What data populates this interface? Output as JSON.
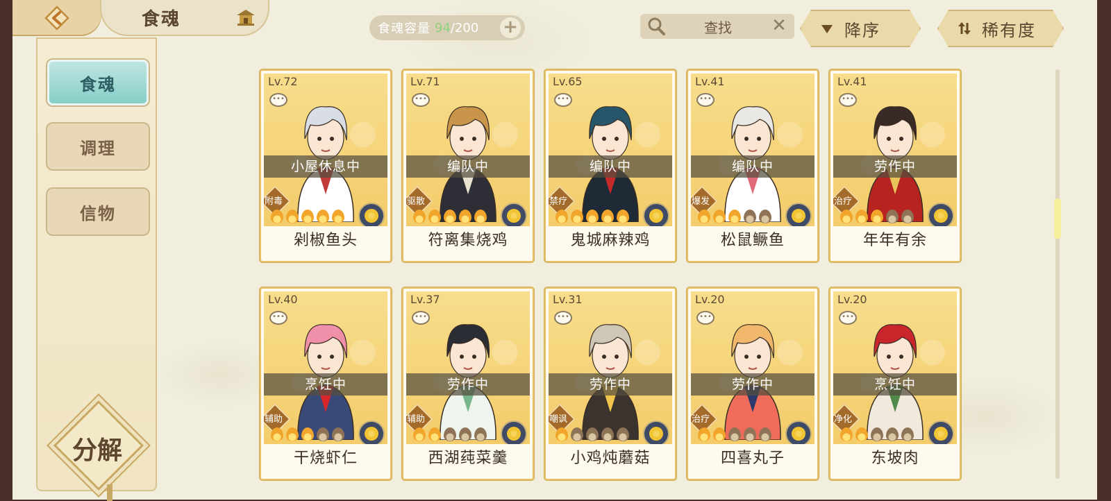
{
  "header": {
    "title": "食魂"
  },
  "capacity": {
    "label": "食魂容量",
    "current": "94",
    "max": "/200",
    "add": "+"
  },
  "search": {
    "text": "查找",
    "clear": "✕"
  },
  "sort": {
    "order_label": "降序",
    "filter_label": "稀有度"
  },
  "sidebar": {
    "items": [
      "食魂",
      "调理",
      "信物"
    ],
    "decompose": "分解"
  },
  "cards": [
    {
      "lv": "Lv.72",
      "status": "小屋休息中",
      "role": "附毒",
      "name": "剁椒鱼头",
      "stars": 5,
      "hair": "#d9dde6",
      "coat": "#ffffff",
      "accent": "#c23b3b"
    },
    {
      "lv": "Lv.71",
      "status": "编队中",
      "role": "驱散",
      "name": "符离集烧鸡",
      "stars": 5,
      "hair": "#c9954a",
      "coat": "#2e2e36",
      "accent": "#e9e2d0"
    },
    {
      "lv": "Lv.65",
      "status": "编队中",
      "role": "禁疗",
      "name": "鬼城麻辣鸡",
      "stars": 5,
      "hair": "#27566b",
      "coat": "#1e2b36",
      "accent": "#c42a28"
    },
    {
      "lv": "Lv.41",
      "status": "编队中",
      "role": "爆发",
      "name": "松鼠鳜鱼",
      "stars": 3,
      "hair": "#e9e8e4",
      "coat": "#ffffff",
      "accent": "#e06a7a"
    },
    {
      "lv": "Lv.41",
      "status": "劳作中",
      "role": "治疗",
      "name": "年年有余",
      "stars": 3,
      "hair": "#3a2a26",
      "coat": "#b7231f",
      "accent": "#e9c55b"
    },
    {
      "lv": "Lv.40",
      "status": "烹饪中",
      "role": "辅助",
      "name": "干烧虾仁",
      "stars": 3,
      "hair": "#ef8fa9",
      "coat": "#3a4a78",
      "accent": "#d8262a"
    },
    {
      "lv": "Lv.37",
      "status": "劳作中",
      "role": "辅助",
      "name": "西湖莼菜羹",
      "stars": 2,
      "hair": "#2a2d33",
      "coat": "#eef5ee",
      "accent": "#77b58a"
    },
    {
      "lv": "Lv.31",
      "status": "劳作中",
      "role": "嘲讽",
      "name": "小鸡炖蘑菇",
      "stars": 1,
      "hair": "#cfc7b5",
      "coat": "#3b342e",
      "accent": "#f2c64a"
    },
    {
      "lv": "Lv.20",
      "status": "劳作中",
      "role": "治疗",
      "name": "四喜丸子",
      "stars": 2,
      "hair": "#f1b86b",
      "coat": "#ef6b5a",
      "accent": "#2b3a6b"
    },
    {
      "lv": "Lv.20",
      "status": "烹饪中",
      "role": "净化",
      "name": "东坡肉",
      "stars": 2,
      "hair": "#c9262b",
      "coat": "#f0e9dc",
      "accent": "#4f8a4a"
    }
  ],
  "colors": {
    "background": "#f1eedd",
    "frame": "#4a3028",
    "accent_teal": "#86cfc8",
    "gold": "#e6c164"
  }
}
